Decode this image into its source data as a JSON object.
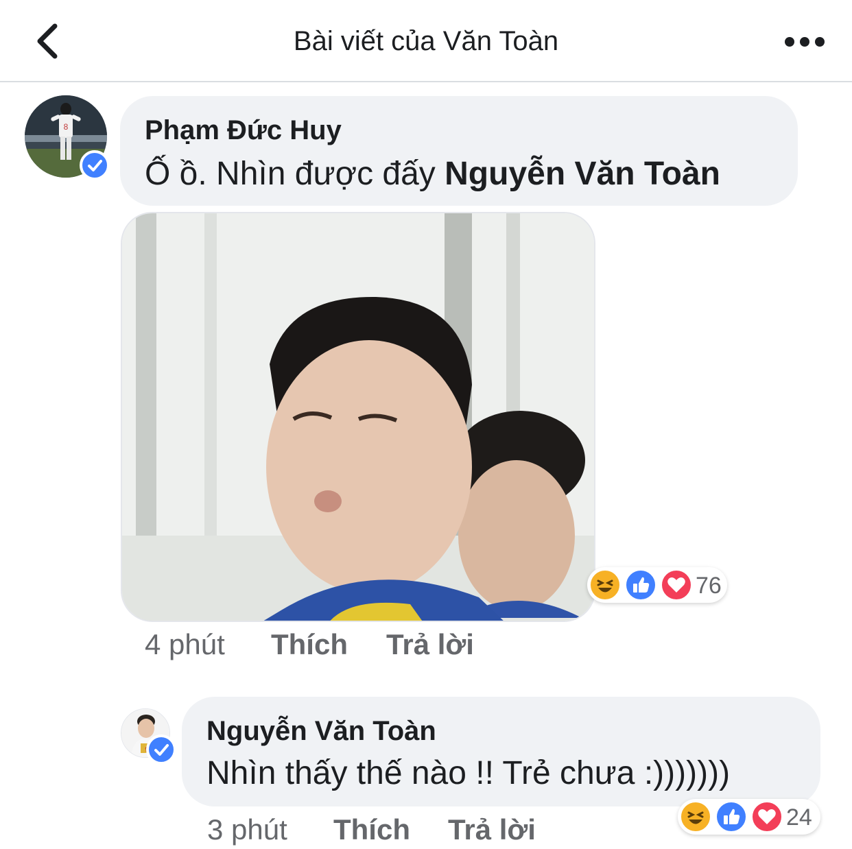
{
  "header": {
    "title": "Bài viết của Văn Toàn"
  },
  "comments": [
    {
      "author": "Phạm Đức Huy",
      "text": "Ố ồ. Nhìn được đấy ",
      "mention": "Nguyễn Văn Toàn",
      "reaction_count": "76",
      "time": "4 phút",
      "like_label": "Thích",
      "reply_label": "Trả lời"
    },
    {
      "author": "Nguyễn Văn Toàn",
      "text": "Nhìn thấy thế nào !! Trẻ chưa :)))))))",
      "reaction_count": "24",
      "time": "3 phút",
      "like_label": "Thích",
      "reply_label": "Trả lời"
    }
  ],
  "icons": {
    "back": "chevron-left-icon",
    "more": "more-horizontal-icon",
    "verified": "verified-badge-icon",
    "reactions": [
      "haha-reaction-icon",
      "like-reaction-icon",
      "love-reaction-icon"
    ]
  },
  "colors": {
    "accent": "#4080ff",
    "bubble": "#f0f2f5",
    "love": "#f33e58",
    "haha": "#f7b125",
    "secondary_text": "#65676b"
  }
}
